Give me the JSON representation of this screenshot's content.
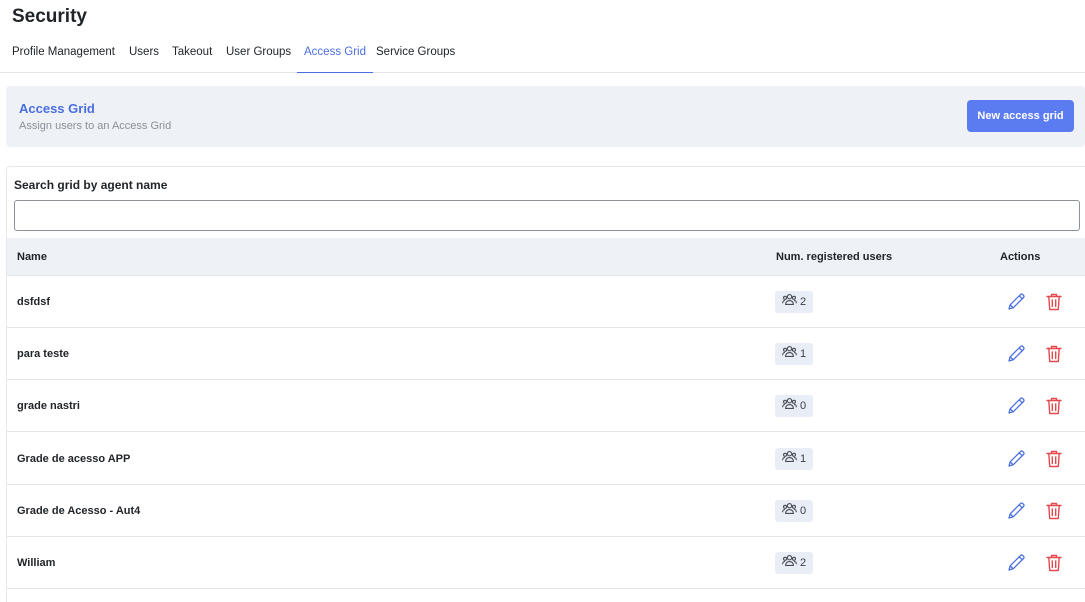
{
  "page": {
    "title": "Security"
  },
  "tabs": [
    {
      "label": "Profile Management",
      "active": false
    },
    {
      "label": "Users",
      "active": false
    },
    {
      "label": "Takeout",
      "active": false
    },
    {
      "label": "User Groups",
      "active": false
    },
    {
      "label": "Access Grid",
      "active": true
    },
    {
      "label": "Service Groups",
      "active": false
    }
  ],
  "panel": {
    "title": "Access Grid",
    "subtitle": "Assign users to an Access Grid",
    "new_button": "New access grid"
  },
  "search": {
    "label": "Search grid by agent name",
    "value": "",
    "placeholder": ""
  },
  "table": {
    "columns": [
      "Name",
      "Num. registered users",
      "Actions"
    ],
    "rows": [
      {
        "name": "dsfdsf",
        "users": "2"
      },
      {
        "name": "para teste",
        "users": "1"
      },
      {
        "name": "grade nastri",
        "users": "0"
      },
      {
        "name": "Grade de acesso APP",
        "users": "1"
      },
      {
        "name": "Grade de Acesso - Aut4",
        "users": "0"
      },
      {
        "name": "William",
        "users": "2"
      }
    ]
  },
  "icons": {
    "users": "users-group-icon",
    "edit": "pencil-icon",
    "delete": "trash-icon"
  },
  "colors": {
    "accent": "#4a6ee0",
    "button": "#5b7bf0",
    "danger": "#e5484d",
    "panel_bg": "#eef1f6"
  }
}
